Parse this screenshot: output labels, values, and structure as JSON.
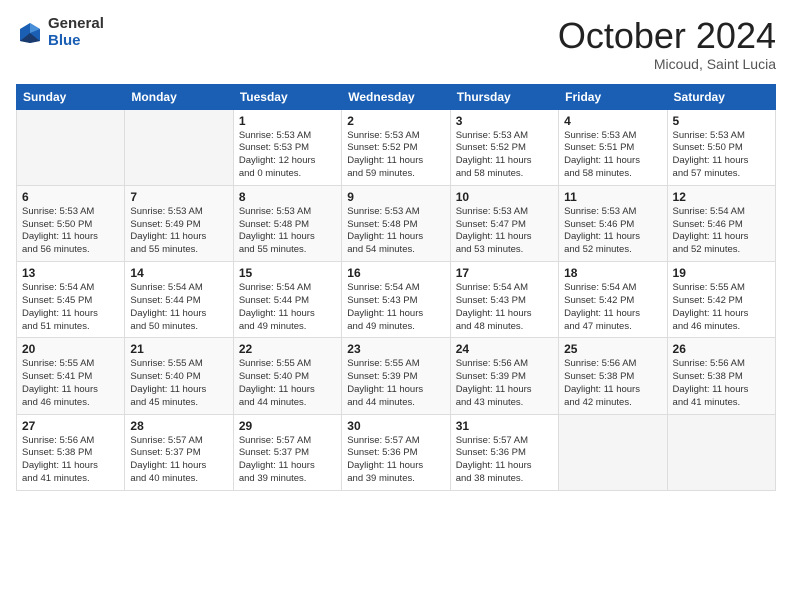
{
  "logo": {
    "general": "General",
    "blue": "Blue"
  },
  "title": "October 2024",
  "subtitle": "Micoud, Saint Lucia",
  "days_header": [
    "Sunday",
    "Monday",
    "Tuesday",
    "Wednesday",
    "Thursday",
    "Friday",
    "Saturday"
  ],
  "weeks": [
    [
      {
        "num": "",
        "info": ""
      },
      {
        "num": "",
        "info": ""
      },
      {
        "num": "1",
        "info": "Sunrise: 5:53 AM\nSunset: 5:53 PM\nDaylight: 12 hours\nand 0 minutes."
      },
      {
        "num": "2",
        "info": "Sunrise: 5:53 AM\nSunset: 5:52 PM\nDaylight: 11 hours\nand 59 minutes."
      },
      {
        "num": "3",
        "info": "Sunrise: 5:53 AM\nSunset: 5:52 PM\nDaylight: 11 hours\nand 58 minutes."
      },
      {
        "num": "4",
        "info": "Sunrise: 5:53 AM\nSunset: 5:51 PM\nDaylight: 11 hours\nand 58 minutes."
      },
      {
        "num": "5",
        "info": "Sunrise: 5:53 AM\nSunset: 5:50 PM\nDaylight: 11 hours\nand 57 minutes."
      }
    ],
    [
      {
        "num": "6",
        "info": "Sunrise: 5:53 AM\nSunset: 5:50 PM\nDaylight: 11 hours\nand 56 minutes."
      },
      {
        "num": "7",
        "info": "Sunrise: 5:53 AM\nSunset: 5:49 PM\nDaylight: 11 hours\nand 55 minutes."
      },
      {
        "num": "8",
        "info": "Sunrise: 5:53 AM\nSunset: 5:48 PM\nDaylight: 11 hours\nand 55 minutes."
      },
      {
        "num": "9",
        "info": "Sunrise: 5:53 AM\nSunset: 5:48 PM\nDaylight: 11 hours\nand 54 minutes."
      },
      {
        "num": "10",
        "info": "Sunrise: 5:53 AM\nSunset: 5:47 PM\nDaylight: 11 hours\nand 53 minutes."
      },
      {
        "num": "11",
        "info": "Sunrise: 5:53 AM\nSunset: 5:46 PM\nDaylight: 11 hours\nand 52 minutes."
      },
      {
        "num": "12",
        "info": "Sunrise: 5:54 AM\nSunset: 5:46 PM\nDaylight: 11 hours\nand 52 minutes."
      }
    ],
    [
      {
        "num": "13",
        "info": "Sunrise: 5:54 AM\nSunset: 5:45 PM\nDaylight: 11 hours\nand 51 minutes."
      },
      {
        "num": "14",
        "info": "Sunrise: 5:54 AM\nSunset: 5:44 PM\nDaylight: 11 hours\nand 50 minutes."
      },
      {
        "num": "15",
        "info": "Sunrise: 5:54 AM\nSunset: 5:44 PM\nDaylight: 11 hours\nand 49 minutes."
      },
      {
        "num": "16",
        "info": "Sunrise: 5:54 AM\nSunset: 5:43 PM\nDaylight: 11 hours\nand 49 minutes."
      },
      {
        "num": "17",
        "info": "Sunrise: 5:54 AM\nSunset: 5:43 PM\nDaylight: 11 hours\nand 48 minutes."
      },
      {
        "num": "18",
        "info": "Sunrise: 5:54 AM\nSunset: 5:42 PM\nDaylight: 11 hours\nand 47 minutes."
      },
      {
        "num": "19",
        "info": "Sunrise: 5:55 AM\nSunset: 5:42 PM\nDaylight: 11 hours\nand 46 minutes."
      }
    ],
    [
      {
        "num": "20",
        "info": "Sunrise: 5:55 AM\nSunset: 5:41 PM\nDaylight: 11 hours\nand 46 minutes."
      },
      {
        "num": "21",
        "info": "Sunrise: 5:55 AM\nSunset: 5:40 PM\nDaylight: 11 hours\nand 45 minutes."
      },
      {
        "num": "22",
        "info": "Sunrise: 5:55 AM\nSunset: 5:40 PM\nDaylight: 11 hours\nand 44 minutes."
      },
      {
        "num": "23",
        "info": "Sunrise: 5:55 AM\nSunset: 5:39 PM\nDaylight: 11 hours\nand 44 minutes."
      },
      {
        "num": "24",
        "info": "Sunrise: 5:56 AM\nSunset: 5:39 PM\nDaylight: 11 hours\nand 43 minutes."
      },
      {
        "num": "25",
        "info": "Sunrise: 5:56 AM\nSunset: 5:38 PM\nDaylight: 11 hours\nand 42 minutes."
      },
      {
        "num": "26",
        "info": "Sunrise: 5:56 AM\nSunset: 5:38 PM\nDaylight: 11 hours\nand 41 minutes."
      }
    ],
    [
      {
        "num": "27",
        "info": "Sunrise: 5:56 AM\nSunset: 5:38 PM\nDaylight: 11 hours\nand 41 minutes."
      },
      {
        "num": "28",
        "info": "Sunrise: 5:57 AM\nSunset: 5:37 PM\nDaylight: 11 hours\nand 40 minutes."
      },
      {
        "num": "29",
        "info": "Sunrise: 5:57 AM\nSunset: 5:37 PM\nDaylight: 11 hours\nand 39 minutes."
      },
      {
        "num": "30",
        "info": "Sunrise: 5:57 AM\nSunset: 5:36 PM\nDaylight: 11 hours\nand 39 minutes."
      },
      {
        "num": "31",
        "info": "Sunrise: 5:57 AM\nSunset: 5:36 PM\nDaylight: 11 hours\nand 38 minutes."
      },
      {
        "num": "",
        "info": ""
      },
      {
        "num": "",
        "info": ""
      }
    ]
  ]
}
